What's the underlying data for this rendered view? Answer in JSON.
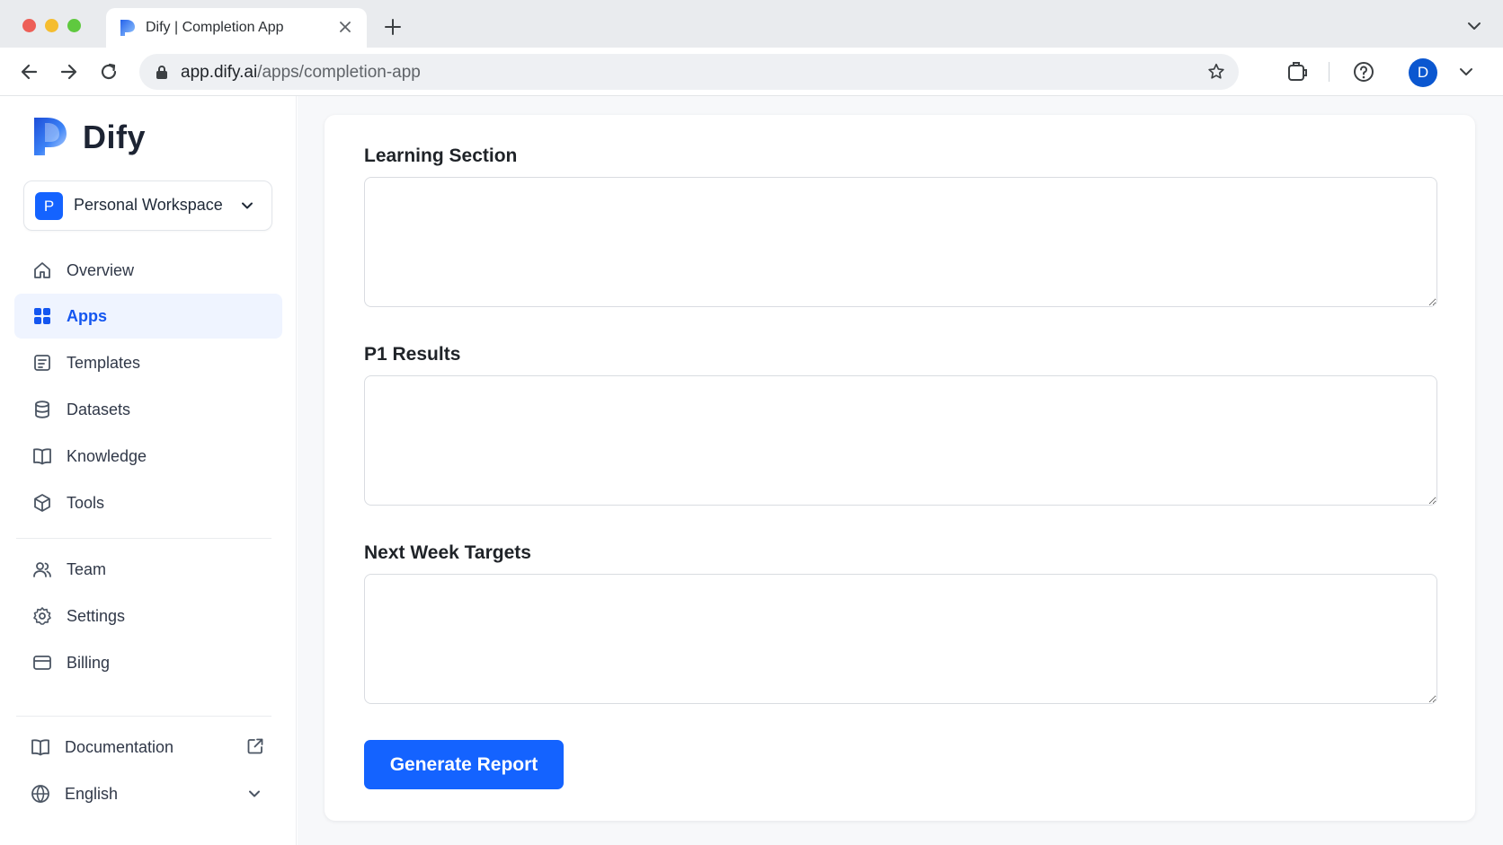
{
  "browser": {
    "tab_title": "Dify | Completion App",
    "url_host": "app.dify.ai",
    "url_path": "/apps/completion-app",
    "profile_initial": "D",
    "icons": [
      "close-icon",
      "plus-icon",
      "chevron-down-icon",
      "back-arrow-icon",
      "forward-arrow-icon",
      "reload-icon",
      "lock-icon",
      "star-icon",
      "extensions-icon",
      "help-icon"
    ]
  },
  "sidebar": {
    "brand": "Dify",
    "workspace": {
      "badge": "P",
      "label": "Personal Workspace"
    },
    "nav": [
      {
        "label": "Overview",
        "icon": "home-icon",
        "active": false
      },
      {
        "label": "Apps",
        "icon": "grid-icon",
        "active": true
      },
      {
        "label": "Templates",
        "icon": "template-icon",
        "active": false
      },
      {
        "label": "Datasets",
        "icon": "database-icon",
        "active": false
      },
      {
        "label": "Knowledge",
        "icon": "book-icon",
        "active": false
      },
      {
        "label": "Tools",
        "icon": "cube-icon",
        "active": false
      }
    ],
    "nav2": [
      {
        "label": "Team",
        "icon": "users-icon"
      },
      {
        "label": "Settings",
        "icon": "gear-icon"
      },
      {
        "label": "Billing",
        "icon": "card-icon"
      }
    ],
    "footer": {
      "documentation": "Documentation",
      "language": "English"
    }
  },
  "form": {
    "fields": [
      {
        "label": "Learning Section",
        "value": "",
        "placeholder": ""
      },
      {
        "label": "P1 Results",
        "value": "",
        "placeholder": ""
      },
      {
        "label": "Next Week Targets",
        "value": "",
        "placeholder": ""
      }
    ],
    "submit_label": "Generate Report"
  },
  "colors": {
    "accent": "#1463ff",
    "active_nav_bg": "#eff4ff",
    "profile": "#0b57d0"
  }
}
